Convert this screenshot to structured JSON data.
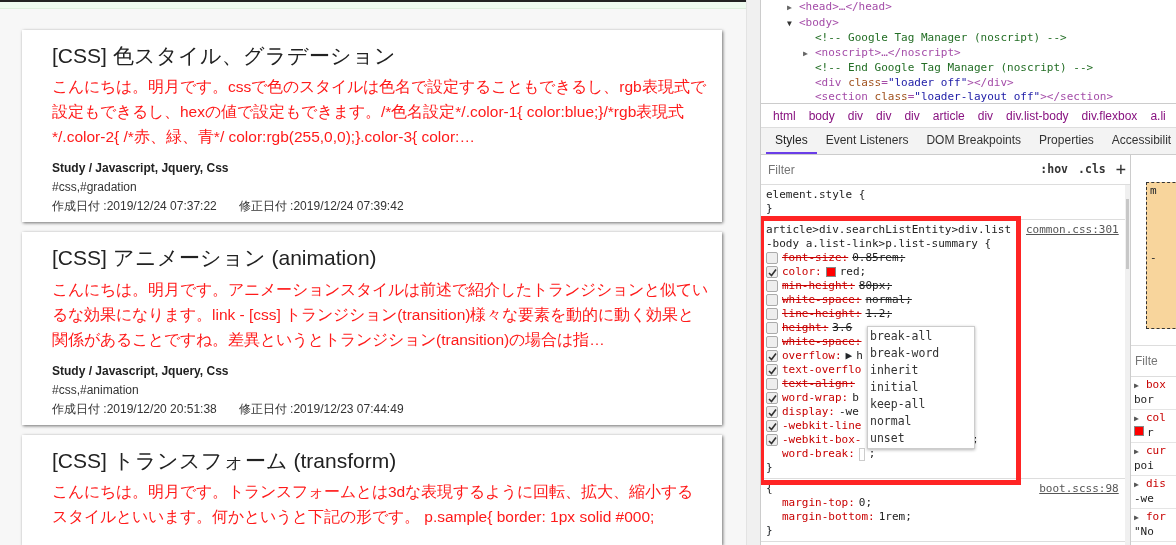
{
  "articles": [
    {
      "title": "[CSS] 色スタイル、グラデーション",
      "summary": "こんにちは。明月です。cssで色のスタイルは色名で設定することもできるし、rgb表現式で設定もできるし、hexの値で設定もできます。/*色名設定*/.color-1{ color:blue;}/*rgb表現式*/.color-2{ /*赤、緑、青*/ color:rgb(255,0,0);}.color-3{ color:…",
      "category": "Study / Javascript, Jquery, Css",
      "tags": "#css,#gradation",
      "created": "作成日付 :2019/12/24 07:37:22",
      "modified": "修正日付 :2019/12/24 07:39:42"
    },
    {
      "title": "[CSS] アニメーション (animation)",
      "summary": "こんにちは。明月です。アニメーションスタイルは前述で紹介したトランジションと似ているな効果になります。link - [css] トランジション(transition)様々な要素を動的に動く効果と関係があることですね。差異というとトランジション(transition)の場合は指…",
      "category": "Study / Javascript, Jquery, Css",
      "tags": "#css,#animation",
      "created": "作成日付 :2019/12/20 20:51:38",
      "modified": "修正日付 :2019/12/23 07:44:49"
    },
    {
      "title": "[CSS] トランスフォーム (transform)",
      "summary": "こんにちは。明月です。トランスフォームとは3dな表現するように回転、拡大、縮小するスタイルといいます。何かというと下記の形です。 p.sample{ border: 1px solid #000;"
    }
  ],
  "devtools": {
    "dom_tree": [
      {
        "kind": "element",
        "markup": "<head>…</head>",
        "toggle": "▶",
        "expanded": false
      },
      {
        "kind": "element",
        "markup": "<body>",
        "toggle": "▼",
        "expanded": true,
        "children": [
          {
            "kind": "comment",
            "markup": "<!-- Google Tag Manager (noscript) -->"
          },
          {
            "kind": "element",
            "markup": "<noscript>…</noscript>",
            "toggle": "▶",
            "expanded": false
          },
          {
            "kind": "comment",
            "markup": "<!-- End Google Tag Manager (noscript) -->"
          },
          {
            "kind": "element",
            "markup": "<div class=\"loader off\"></div>"
          },
          {
            "kind": "element",
            "markup": "<section class=\"loader-layout off\"></section>"
          }
        ]
      }
    ],
    "breadcrumbs": [
      "html",
      "body",
      "div",
      "div",
      "div",
      "article",
      "div",
      "div.list-body",
      "div.flexbox",
      "a.li"
    ],
    "tabs": [
      {
        "label": "Styles",
        "selected": true
      },
      {
        "label": "Event Listeners",
        "selected": false
      },
      {
        "label": "DOM Breakpoints",
        "selected": false
      },
      {
        "label": "Properties",
        "selected": false
      },
      {
        "label": "Accessibilit",
        "selected": false
      }
    ],
    "filter": {
      "placeholder": "Filter",
      "hov": ":hov",
      "cls": ".cls",
      "add": "+"
    },
    "rules": [
      {
        "selector": "element.style {",
        "close": "}"
      },
      {
        "selector": "article>div.searchListEntity>div.list-body a.list-link>p.list-summary {",
        "source": "common.css:301",
        "close": "}",
        "highlighted": true,
        "properties": [
          {
            "name": "font-size:",
            "value": "0.85rem;",
            "checked": false,
            "overridden": true
          },
          {
            "name": "color:",
            "value": "red;",
            "color": "#ff0000",
            "checked": true,
            "overridden": false
          },
          {
            "name": "min-height:",
            "value": "80px;",
            "checked": false,
            "overridden": true
          },
          {
            "name": "white-space:",
            "value": "normal;",
            "checked": false,
            "overridden": true
          },
          {
            "name": "line-height:",
            "value": "1.2;",
            "checked": false,
            "overridden": true
          },
          {
            "name": "height:",
            "value": "3.6",
            "checked": false,
            "overridden": true
          },
          {
            "name": "white-space:",
            "checked": false,
            "overridden": true
          },
          {
            "name": "overflow:",
            "value": "h",
            "expander": "▶",
            "checked": true,
            "overridden": false
          },
          {
            "name": "text-overflo",
            "checked": true,
            "overridden": false
          },
          {
            "name": "text-align:",
            "checked": false,
            "overridden": true
          },
          {
            "name": "word-wrap:",
            "value": "b",
            "checked": true,
            "overridden": false
          },
          {
            "name": "display:",
            "value": "-we",
            "checked": true,
            "overridden": false
          },
          {
            "name": "-webkit-line",
            "checked": true,
            "overridden": false
          },
          {
            "name": "-webkit-box-",
            "tail": ";",
            "checked": true,
            "overridden": false
          },
          {
            "name": "word-break:",
            "value": ";",
            "editing": true
          }
        ]
      },
      {
        "selector": "{",
        "source": "boot.scss:98",
        "close": "}",
        "properties": [
          {
            "name": "margin-top:",
            "value": "0;"
          },
          {
            "name": "margin-bottom:",
            "value": "1rem;"
          }
        ]
      }
    ],
    "autocomplete": [
      "break-all",
      "break-word",
      "inherit",
      "initial",
      "keep-all",
      "normal",
      "unset"
    ],
    "box_model": {
      "label": "m",
      "dash": "-"
    },
    "computed": {
      "placeholder": "Filte",
      "items": [
        {
          "toggle": "▶",
          "name": "box",
          "value": "bor"
        },
        {
          "toggle": "▶",
          "name": "col",
          "color": "#ff0000",
          "value": "r"
        },
        {
          "toggle": "▶",
          "name": "cur",
          "value": "poi"
        },
        {
          "toggle": "▶",
          "name": "dis",
          "value": "-we"
        },
        {
          "toggle": "▶",
          "name": "for",
          "value": "\"No"
        }
      ]
    }
  }
}
